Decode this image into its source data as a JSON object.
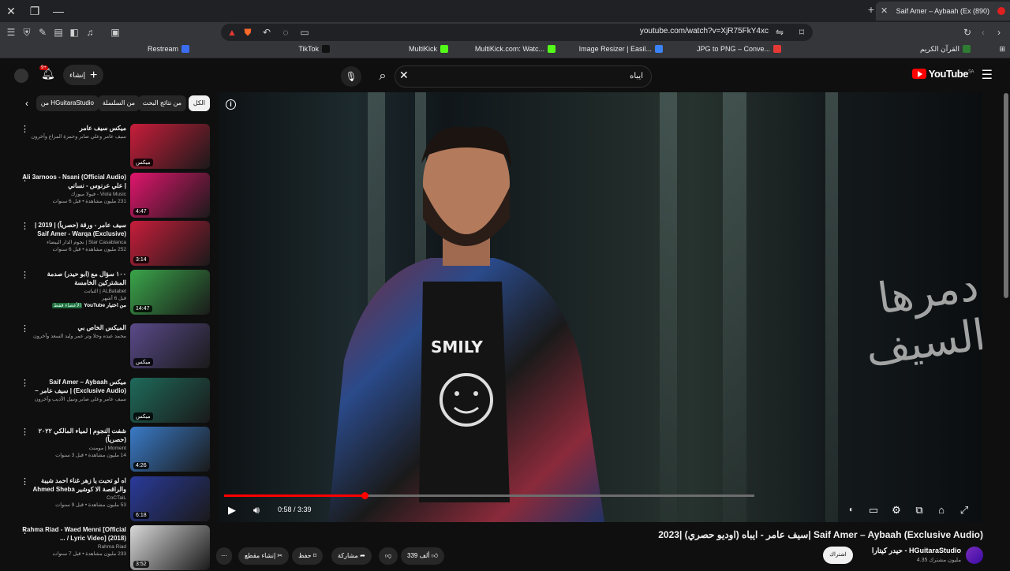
{
  "browser": {
    "tab_title": "(890) Saif Amer – Aybaah (Ex",
    "url": "youtube.com/watch?v=XjR75FkY4xc",
    "bookmarks": [
      {
        "label": "Restream",
        "color": "#3a6df0"
      },
      {
        "label": "TikTok",
        "color": "#111111"
      },
      {
        "label": "MultiKick",
        "color": "#53fc18"
      },
      {
        "label": "MultiKick.com: Watc...",
        "color": "#53fc18"
      },
      {
        "label": "Image Resizer | Easil...",
        "color": "#3b82f6"
      },
      {
        "label": "JPG to PNG – Conve...",
        "color": "#e53935"
      },
      {
        "label": "القرآن الكريم",
        "color": "#2e7d32"
      }
    ]
  },
  "header": {
    "logo": "YouTube",
    "logo_region": "SA",
    "search_value": "ايباه",
    "create_label": "إنشاء",
    "notif_count": "9+"
  },
  "chips": [
    "الكل",
    "من نتائج البحث",
    "من السلسلة",
    "من HGuitaraStudio"
  ],
  "recommendations": [
    {
      "title": "ميكس سيف عامر",
      "channel": "سيف عامر وعلي صابر وحمزة المزاع وآخرون",
      "meta": "",
      "badge": "ميكس",
      "thumb": "#c81d3a"
    },
    {
      "title": "Ali 3arnoos - Nsani (Official Audio) | علي عرنوس - نساني",
      "channel": "Viola Music - فيولا ميوزك",
      "meta": "231 مليون مشاهدة • قبل 6 سنوات",
      "badge": "4:47",
      "thumb": "#e0156c"
    },
    {
      "title": "سيف عامر - ورقة (حصرياً) | 2019 | Saif Amer - Warqa (Exclusive)",
      "channel": "Star Casablanca | نجوم الدار البيضاء",
      "meta": "252 مليون مشاهدة • قبل 6 سنوات",
      "badge": "3:14",
      "thumb": "#c81d3a"
    },
    {
      "title": "١٠٠ سؤال مع (ابو حيدر) صدمة المشتركين الخامسة",
      "channel": "ALBatabet | الثباتت",
      "meta": "قبل 6 أشهر",
      "extra": "من اختيار YouTube",
      "extra_tag": "الأعضاء فقط",
      "badge": "14:47",
      "thumb": "#3aa54a"
    },
    {
      "title": "الميكس الخاص بي",
      "channel": "محمد عبده وحلا وتر عمر وليد السعد وآخرون",
      "meta": "",
      "badge": "ميكس",
      "thumb": "#5a4a8a"
    },
    {
      "title": "ميكس Saif Amer – Aybaah (Exclusive Audio) | سيف عامر – ايباه...",
      "channel": "سيف عامر وعلي صابر ونبيل الأديب وآخرون",
      "meta": "",
      "badge": "ميكس",
      "thumb": "#1e6a5a"
    },
    {
      "title": "شفت النجوم | لمياء المالكي ٢٠٢٢ (حصرياً)",
      "channel": "Moment | مومنت",
      "meta": "14 مليون مشاهدة • قبل 3 سنوات",
      "badge": "4:26",
      "thumb": "#3a7bc8"
    },
    {
      "title": "اه لو تحبت يا زهر غناء احمد شيبة والراقصة الا كوشير Ahmed Sheba",
      "channel": "CoCTaiL",
      "meta": "53 مليون مشاهدة • قبل 9 سنوات",
      "badge": "6:18",
      "thumb": "#2a3a9a"
    },
    {
      "title": "Rahma Riad - Waed Menni [Official Lyric Video] (2018) / ...",
      "channel": "Rahma Riad",
      "meta": "233 مليون مشاهدة • قبل 7 سنوات",
      "badge": "3:52",
      "thumb": "#d8d8d8"
    }
  ],
  "player": {
    "time": "0:58 / 3:39",
    "progress_fraction": 0.265,
    "loaded_fraction": 1.0,
    "overlay_text": "دمرها السيف"
  },
  "video": {
    "title": "سيف عامر - ايباه (اوديو حصري) |2023| Saif Amer – Aybaah (Exclusive Audio)",
    "channel": "حيدر كيتارا - HGuitaraStudio",
    "subs": "4.35 مليون مشترك",
    "subscribe": "اشتراك",
    "likes": "339 ألف",
    "share": "مشاركة",
    "save": "حفظ",
    "clip": "إنشاء مقطع"
  }
}
